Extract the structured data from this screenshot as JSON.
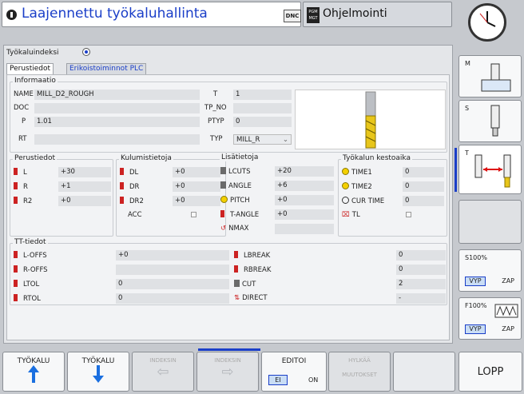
{
  "header": {
    "title": "Laajennettu työkaluhallinta",
    "dnc": "DNC",
    "mode": "Ohjelmointi",
    "pgm": "PGM MGT"
  },
  "index": {
    "label": "Työkaluindeksi"
  },
  "tabs": [
    "Perustiedot",
    "Erikoistoiminnot PLC"
  ],
  "info": {
    "title": "Informaatio",
    "name_label": "NAME",
    "name": "MILL_D2_ROUGH",
    "doc_label": "DOC",
    "doc": "",
    "p_label": "P",
    "p": "1.01",
    "rt_label": "RT",
    "rt": "",
    "t_label": "T",
    "t": "1",
    "tpno_label": "TP_NO",
    "tpno": "",
    "ptyp_label": "PTYP",
    "ptyp": "0",
    "typ_label": "TYP",
    "typ": "MILL_R"
  },
  "basic": {
    "title": "Perustiedot",
    "rows": [
      {
        "l": "L",
        "v": "+30"
      },
      {
        "l": "R",
        "v": "+1"
      },
      {
        "l": "R2",
        "v": "+0"
      }
    ]
  },
  "wear": {
    "title": "Kulumistietoja",
    "rows": [
      {
        "l": "DL",
        "v": "+0"
      },
      {
        "l": "DR",
        "v": "+0"
      },
      {
        "l": "DR2",
        "v": "+0"
      }
    ],
    "acc": "ACC"
  },
  "extra": {
    "title": "Lisätietoja",
    "rows": [
      {
        "l": "LCUTS",
        "v": "+20"
      },
      {
        "l": "ANGLE",
        "v": "+6"
      },
      {
        "l": "PITCH",
        "v": "+0"
      },
      {
        "l": "T-ANGLE",
        "v": "+0"
      },
      {
        "l": "NMAX",
        "v": ""
      }
    ]
  },
  "life": {
    "title": "Työkalun kestoaika",
    "rows": [
      {
        "l": "TIME1",
        "v": "0"
      },
      {
        "l": "TIME2",
        "v": "0"
      },
      {
        "l": "CUR TIME",
        "v": "0"
      }
    ],
    "tl": "TL"
  },
  "tt": {
    "title": "TT-tiedot",
    "left": [
      {
        "l": "L-OFFS",
        "v": "+0"
      },
      {
        "l": "R-OFFS",
        "v": ""
      },
      {
        "l": "LTOL",
        "v": "0"
      },
      {
        "l": "RTOL",
        "v": "0"
      }
    ],
    "right": [
      {
        "l": "LBREAK",
        "v": "0"
      },
      {
        "l": "RBREAK",
        "v": "0"
      },
      {
        "l": "CUT",
        "v": "2"
      },
      {
        "l": "DIRECT",
        "v": "-"
      }
    ]
  },
  "side": {
    "m": "M",
    "s": "S",
    "t": "T",
    "s100": "S100%",
    "f100": "F100%",
    "vyp": "VYP",
    "zap": "ZAP"
  },
  "bottom": {
    "b1": "TYÖKALU",
    "b2": "TYÖKALU",
    "b3": "INDEKSIN",
    "b4": "INDEKSIN",
    "b5": "EDITOI",
    "ei": "EI",
    "on": "ON",
    "b6a": "HYLKÄÄ",
    "b6b": "MUUTOKSET",
    "end": "LOPP"
  }
}
